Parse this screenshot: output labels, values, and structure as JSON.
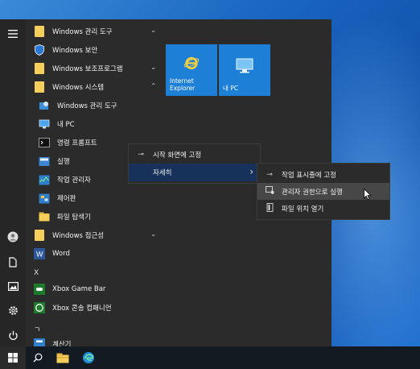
{
  "applist": {
    "items": [
      {
        "label": "Windows 관리 도구",
        "chevron": "⌄"
      },
      {
        "label": "Windows 보안"
      },
      {
        "label": "Windows 보조프로그램",
        "chevron": "⌄"
      },
      {
        "label": "Windows 시스템",
        "chevron": "⌃"
      },
      {
        "label": "Windows 관리 도구"
      },
      {
        "label": "내 PC"
      },
      {
        "label": "명령 프롬프트"
      },
      {
        "label": "실행"
      },
      {
        "label": "작업 관리자"
      },
      {
        "label": "제어판"
      },
      {
        "label": "파일 탐색기"
      },
      {
        "label": "Windows 접근성",
        "chevron": "⌄"
      },
      {
        "label": "Word"
      },
      {
        "label": "Xbox Game Bar"
      },
      {
        "label": "Xbox 콘솔 컴패니언"
      },
      {
        "label": "계산기"
      }
    ],
    "letters": [
      "X",
      "ㄱ"
    ]
  },
  "tiles": [
    {
      "label": "Internet Explorer",
      "icon": "internet-explorer-icon"
    },
    {
      "label": "내 PC",
      "icon": "this-pc-icon"
    }
  ],
  "context_menu": {
    "items": [
      {
        "label": "시작 화면에 고정",
        "icon": "pin-icon"
      },
      {
        "label": "자세히",
        "submenu_arrow": "›"
      }
    ]
  },
  "submenu": {
    "items": [
      {
        "label": "작업 표시줄에 고정",
        "icon": "pin-icon"
      },
      {
        "label": "관리자 권한으로 실행",
        "icon": "admin-run-icon"
      },
      {
        "label": "파일 위치 열기",
        "icon": "open-file-location-icon"
      }
    ]
  },
  "colors": {
    "tile_blue": "#1e7fd6",
    "menu_bg": "#2b2b2b",
    "highlight_navy": "#16315a",
    "hover_gray": "#474747",
    "folder_yellow": "#f6cf5a"
  }
}
